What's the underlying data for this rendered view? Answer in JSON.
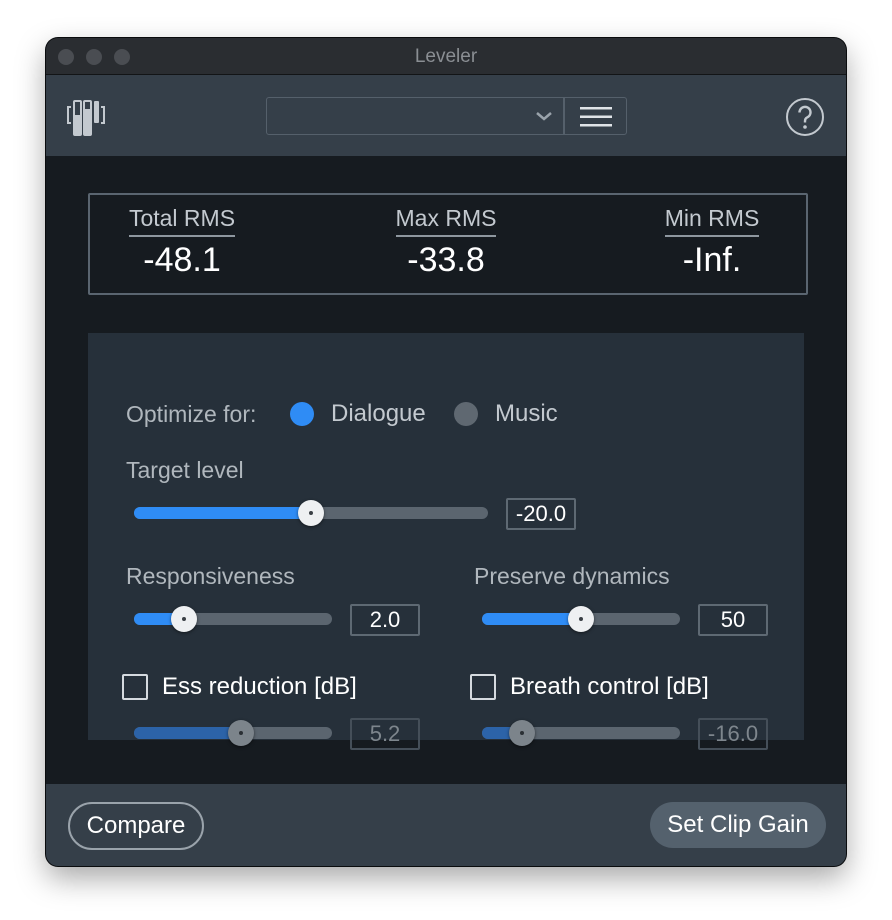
{
  "window": {
    "title": "Leveler"
  },
  "toolbar": {
    "preset_value": ""
  },
  "meters": {
    "total": {
      "label": "Total RMS",
      "value": "-48.1"
    },
    "max": {
      "label": "Max RMS",
      "value": "-33.8"
    },
    "min": {
      "label": "Min RMS",
      "value": "-Inf."
    }
  },
  "optimize": {
    "label": "Optimize for:",
    "options": [
      {
        "label": "Dialogue",
        "selected": true
      },
      {
        "label": "Music",
        "selected": false
      }
    ]
  },
  "target_level": {
    "label": "Target level",
    "value": "-20.0",
    "fraction": 0.5
  },
  "responsiveness": {
    "label": "Responsiveness",
    "value": "2.0",
    "fraction": 0.25
  },
  "preserve_dynamics": {
    "label": "Preserve dynamics",
    "value": "50",
    "fraction": 0.5
  },
  "ess_reduction": {
    "label": "Ess reduction [dB]",
    "value": "5.2",
    "checked": false,
    "fraction": 0.54
  },
  "breath_control": {
    "label": "Breath control [dB]",
    "value": "-16.0",
    "checked": false,
    "fraction": 0.2
  },
  "footer": {
    "compare_label": "Compare",
    "set_clip_gain_label": "Set Clip Gain"
  },
  "colors": {
    "accent": "#2f8cf5",
    "panel": "#26303a",
    "background": "#161b20",
    "toolbar": "#353f49"
  }
}
